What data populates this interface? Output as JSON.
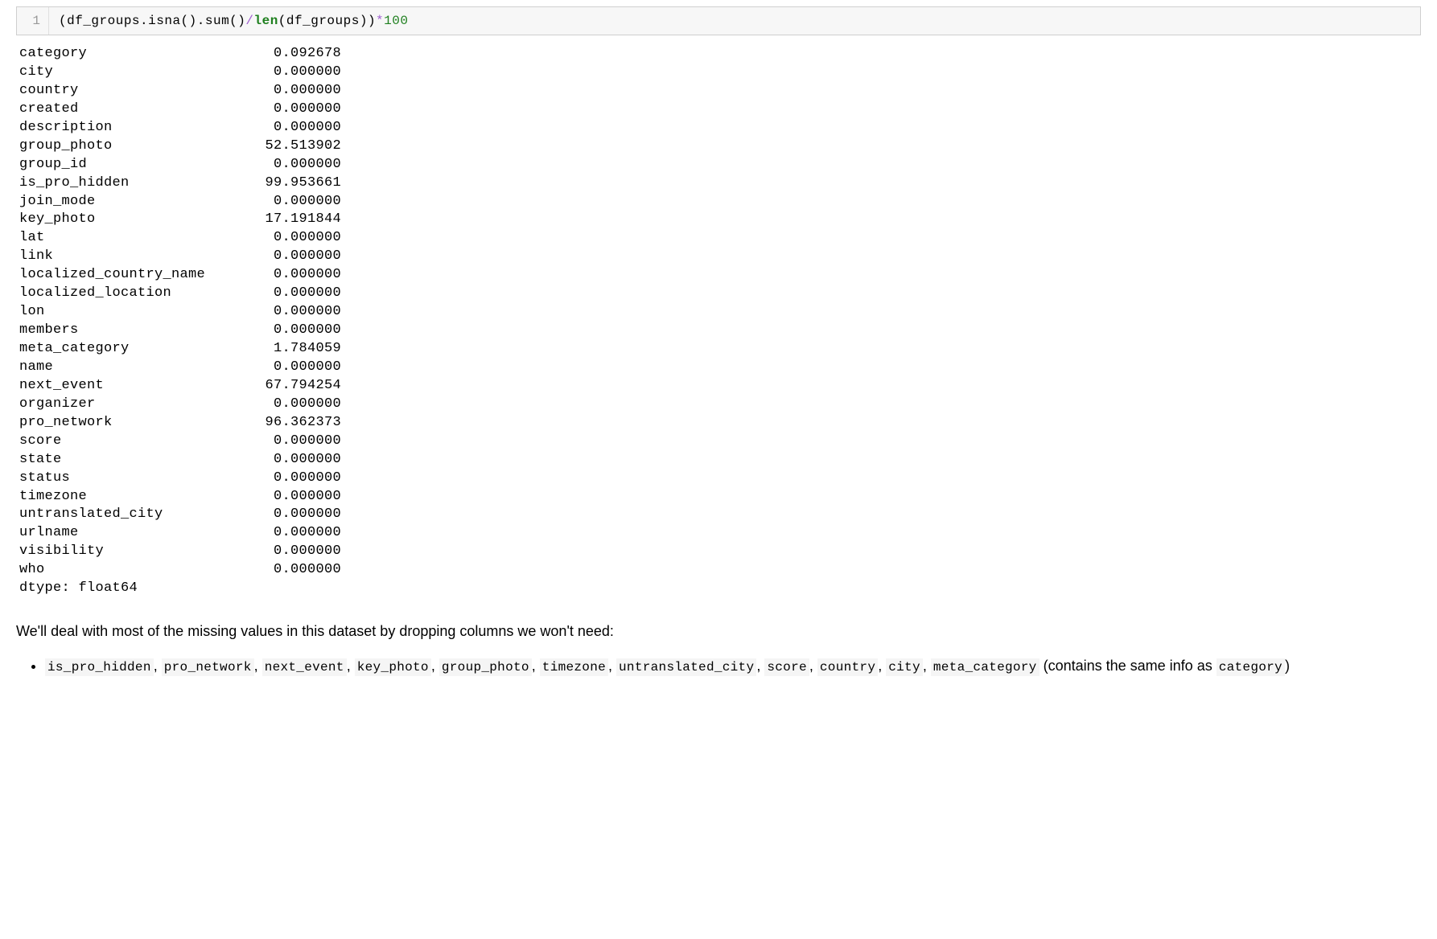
{
  "code": {
    "line_number": "1",
    "tokens": {
      "lparen1": "(",
      "df_groups1": "df_groups",
      "dot1": ".",
      "isna": "isna",
      "parens1": "()",
      "dot2": ".",
      "sum": "sum",
      "parens2": "()",
      "slash": "/",
      "len": "len",
      "lparen2": "(",
      "df_groups2": "df_groups",
      "rparen2": ")",
      "rparen1": ")",
      "star": "*",
      "hundred": "100"
    }
  },
  "output": {
    "rows": [
      {
        "key": "category",
        "value": "0.092678"
      },
      {
        "key": "city",
        "value": "0.000000"
      },
      {
        "key": "country",
        "value": "0.000000"
      },
      {
        "key": "created",
        "value": "0.000000"
      },
      {
        "key": "description",
        "value": "0.000000"
      },
      {
        "key": "group_photo",
        "value": "52.513902"
      },
      {
        "key": "group_id",
        "value": "0.000000"
      },
      {
        "key": "is_pro_hidden",
        "value": "99.953661"
      },
      {
        "key": "join_mode",
        "value": "0.000000"
      },
      {
        "key": "key_photo",
        "value": "17.191844"
      },
      {
        "key": "lat",
        "value": "0.000000"
      },
      {
        "key": "link",
        "value": "0.000000"
      },
      {
        "key": "localized_country_name",
        "value": "0.000000"
      },
      {
        "key": "localized_location",
        "value": "0.000000"
      },
      {
        "key": "lon",
        "value": "0.000000"
      },
      {
        "key": "members",
        "value": "0.000000"
      },
      {
        "key": "meta_category",
        "value": "1.784059"
      },
      {
        "key": "name",
        "value": "0.000000"
      },
      {
        "key": "next_event",
        "value": "67.794254"
      },
      {
        "key": "organizer",
        "value": "0.000000"
      },
      {
        "key": "pro_network",
        "value": "96.362373"
      },
      {
        "key": "score",
        "value": "0.000000"
      },
      {
        "key": "state",
        "value": "0.000000"
      },
      {
        "key": "status",
        "value": "0.000000"
      },
      {
        "key": "timezone",
        "value": "0.000000"
      },
      {
        "key": "untranslated_city",
        "value": "0.000000"
      },
      {
        "key": "urlname",
        "value": "0.000000"
      },
      {
        "key": "visibility",
        "value": "0.000000"
      },
      {
        "key": "who",
        "value": "0.000000"
      }
    ],
    "dtype_line": "dtype: float64"
  },
  "markdown": {
    "intro": "We'll deal with most of the missing values in this dataset by dropping columns we won't need:",
    "bullet_codes": [
      "is_pro_hidden",
      "pro_network",
      "next_event",
      "key_photo",
      "group_photo",
      "timezone",
      "untranslated_city",
      "score",
      "country",
      "city",
      "meta_category"
    ],
    "bullet_paren_pre": " (contains the same info as ",
    "bullet_paren_code": "category",
    "bullet_paren_post": ")",
    "comma_sep": ", "
  }
}
